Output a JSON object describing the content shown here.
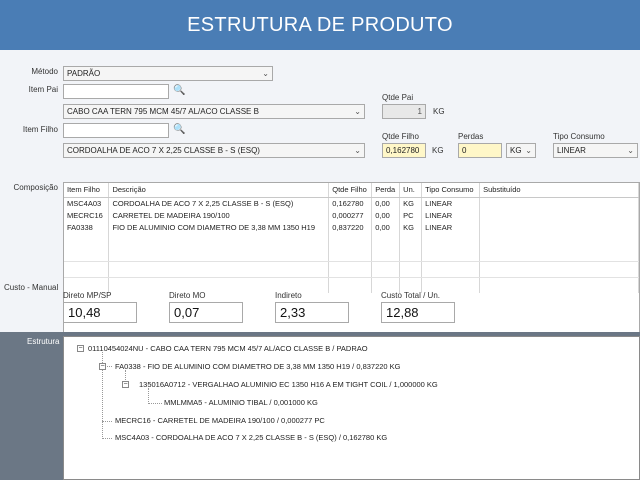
{
  "header": {
    "title": "ESTRUTURA DE PRODUTO"
  },
  "form": {
    "metodo_label": "Método",
    "metodo_value": "PADRÃO",
    "item_pai_label": "Item Pai",
    "item_pai_search": "",
    "item_pai_desc": "CABO CAA TERN 795 MCM 45/7  AL/ACO CLASSE B",
    "qtde_pai_label": "Qtde Pai",
    "qtde_pai_value": "1",
    "qtde_pai_unit": "KG",
    "item_filho_label": "Item Filho",
    "item_filho_search": "",
    "item_filho_desc": "CORDOALHA DE ACO 7 X 2,25 CLASSE B - S (ESQ)",
    "qtde_filho_label": "Qtde Filho",
    "qtde_filho_value": "0,162780",
    "qtde_filho_unit": "KG",
    "perdas_label": "Perdas",
    "perdas_value": "0",
    "perdas_unit": "KG",
    "tipo_consumo_label": "Tipo Consumo",
    "tipo_consumo_value": "LINEAR"
  },
  "composicao": {
    "label": "Composição",
    "columns": [
      "Item Filho",
      "Descrição",
      "Qtde Filho",
      "Perda",
      "Un.",
      "Tipo Consumo",
      "Substituído"
    ],
    "rows": [
      [
        "MSC4A03",
        "CORDOALHA DE ACO 7 X 2,25 CLASSE B - S (ESQ)",
        "0,162780",
        "0,00",
        "KG",
        "LINEAR",
        ""
      ],
      [
        "MECRC16",
        "CARRETEL DE MADEIRA 190/100",
        "0,000277",
        "0,00",
        "PC",
        "LINEAR",
        ""
      ],
      [
        "FA0338",
        "FIO DE ALUMINIO COM DIAMETRO DE 3,38 MM 1350 H19",
        "0,837220",
        "0,00",
        "KG",
        "LINEAR",
        ""
      ]
    ]
  },
  "custo": {
    "label": "Custo - Manual",
    "direto_mp_label": "Direto MP/SP",
    "direto_mp_value": "10,48",
    "direto_mo_label": "Direto MO",
    "direto_mo_value": "0,07",
    "indireto_label": "Indireto",
    "indireto_value": "2,33",
    "total_label": "Custo Total / Un.",
    "total_value": "12,88"
  },
  "estrutura": {
    "label": "Estrutura",
    "nodes": [
      "01110454024NU - CABO CAA TERN 795 MCM 45/7  AL/ACO CLASSE B / PADRAO",
      "FA0338 - FIO DE ALUMINIO COM DIAMETRO DE 3,38 MM 1350 H19 / 0,837220 KG",
      "135016A0712 - VERGALHAO ALUMINIO EC 1350 H16 A EM TIGHT COIL / 1,000000 KG",
      "MMLMMA5 - ALUMINIO TIBAL / 0,001000 KG",
      "MECRC16 - CARRETEL DE MADEIRA 190/100 / 0,000277 PC",
      "MSC4A03 - CORDOALHA DE ACO 7 X 2,25 CLASSE B - S (ESQ) / 0,162780 KG"
    ]
  },
  "icons": {
    "search": "search-icon",
    "dropdown": "chevron-down-icon",
    "tree_expand": "tree-collapse-icon"
  }
}
